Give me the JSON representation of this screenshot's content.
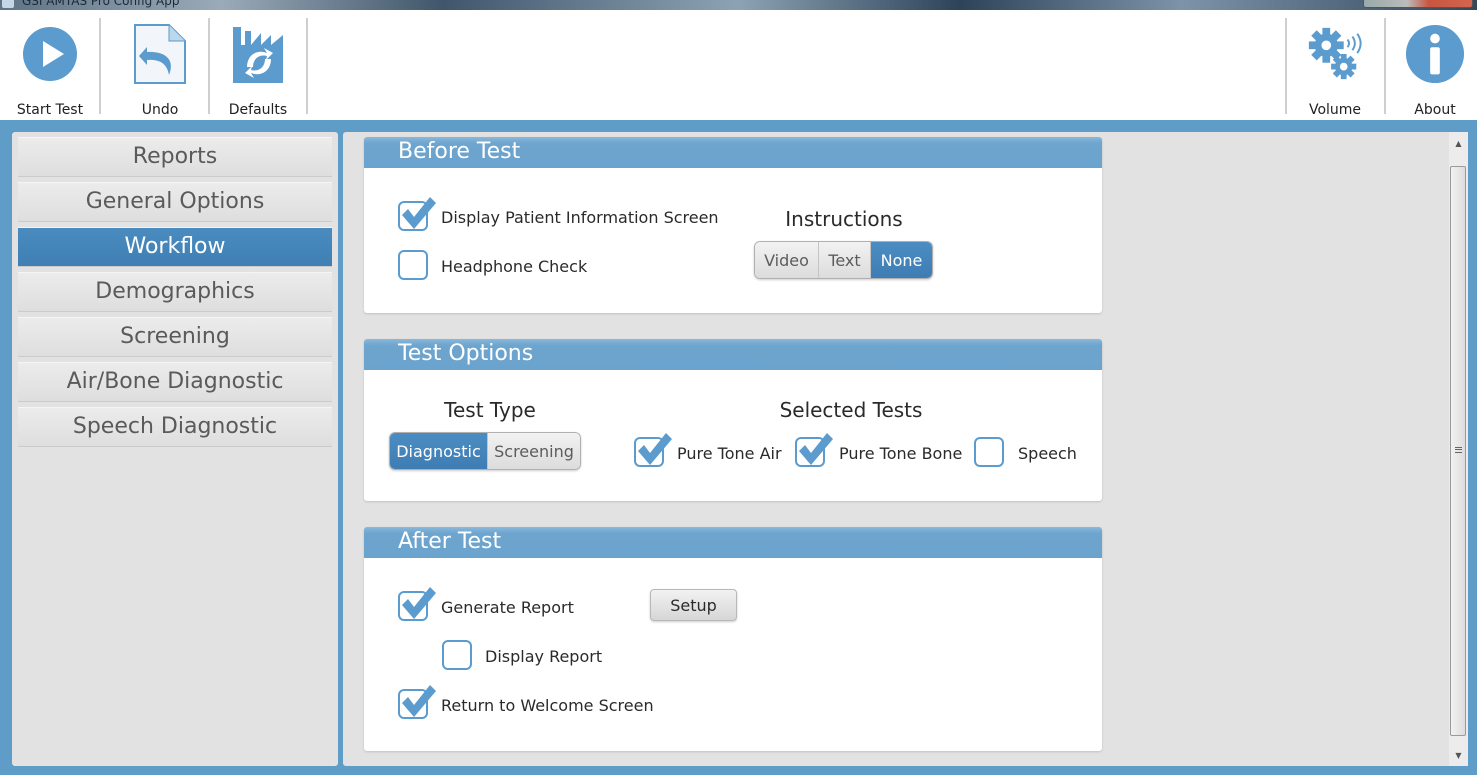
{
  "window": {
    "title": "GSI AMTAS Pro Config App"
  },
  "toolbar": {
    "left": [
      {
        "id": "start-test",
        "label": "Start Test",
        "icon": "play-icon"
      },
      {
        "id": "undo",
        "label": "Undo",
        "icon": "undo-icon"
      },
      {
        "id": "defaults",
        "label": "Defaults",
        "icon": "defaults-icon"
      }
    ],
    "right": [
      {
        "id": "volume",
        "label": "Volume",
        "icon": "gears-volume-icon"
      },
      {
        "id": "about",
        "label": "About",
        "icon": "info-icon"
      }
    ]
  },
  "sidebar": {
    "items": [
      {
        "label": "Reports",
        "active": false
      },
      {
        "label": "General Options",
        "active": false
      },
      {
        "label": "Workflow",
        "active": true
      },
      {
        "label": "Demographics",
        "active": false
      },
      {
        "label": "Screening",
        "active": false
      },
      {
        "label": "Air/Bone Diagnostic",
        "active": false
      },
      {
        "label": "Speech Diagnostic",
        "active": false
      }
    ]
  },
  "before_test": {
    "title": "Before Test",
    "display_patient_info": {
      "label": "Display Patient Information Screen",
      "checked": true
    },
    "headphone_check": {
      "label": "Headphone Check",
      "checked": false
    },
    "instructions": {
      "label": "Instructions",
      "options": [
        "Video",
        "Text",
        "None"
      ],
      "selected": "None"
    }
  },
  "test_options": {
    "title": "Test Options",
    "test_type": {
      "label": "Test Type",
      "options": [
        "Diagnostic",
        "Screening"
      ],
      "selected": "Diagnostic"
    },
    "selected_tests": {
      "label": "Selected Tests",
      "items": [
        {
          "label": "Pure Tone Air",
          "checked": true
        },
        {
          "label": "Pure Tone Bone",
          "checked": true
        },
        {
          "label": "Speech",
          "checked": false
        }
      ]
    }
  },
  "after_test": {
    "title": "After Test",
    "generate_report": {
      "label": "Generate Report",
      "checked": true
    },
    "setup_button": "Setup",
    "display_report": {
      "label": "Display Report",
      "checked": false
    },
    "return_welcome": {
      "label": "Return to Welcome Screen",
      "checked": true
    }
  },
  "colors": {
    "accent": "#6aa3cd",
    "selected": "#3f7fb4",
    "frame": "#5f9dc8",
    "panel_bg": "#e2e2e2"
  }
}
